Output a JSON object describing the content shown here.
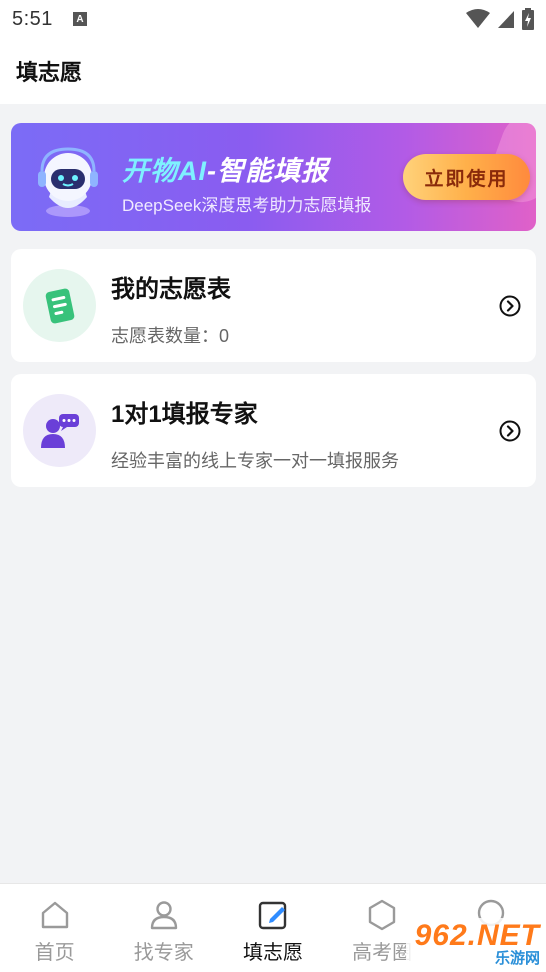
{
  "status_bar": {
    "time": "5:51",
    "a_badge": "A",
    "icons": [
      "notification-a-icon",
      "wifi-icon",
      "signal-icon",
      "battery-icon"
    ]
  },
  "header": {
    "title": "填志愿"
  },
  "banner": {
    "title_main": "开物AI",
    "title_rest": "-智能填报",
    "subtitle": "DeepSeek深度思考助力志愿填报",
    "button_label": "立即使用",
    "icon": "ai-robot-icon"
  },
  "cards": [
    {
      "title": "我的志愿表",
      "subtitle": "志愿表数量：0",
      "icon": "form-list-icon"
    },
    {
      "title": "1对1填报专家",
      "subtitle": "经验丰富的线上专家一对一填报服务",
      "icon": "expert-chat-icon"
    }
  ],
  "bottom_nav": {
    "items": [
      {
        "label": "首页",
        "icon": "home-icon"
      },
      {
        "label": "找专家",
        "icon": "person-icon"
      },
      {
        "label": "填志愿",
        "icon": "edit-icon",
        "active": true
      },
      {
        "label": "高考圈",
        "icon": "hexagon-icon"
      },
      {
        "label": "",
        "icon": "profile-icon"
      }
    ]
  },
  "watermark": {
    "main": "962.NET",
    "sub": "乐游网"
  },
  "colors": {
    "accent": "#6c5ce7",
    "banner_start": "#7b6cf6",
    "banner_end": "#e061c8",
    "button_orange": "#ff8a3d",
    "card_green": "#2fbf71",
    "card_purple": "#6a3fd8"
  }
}
